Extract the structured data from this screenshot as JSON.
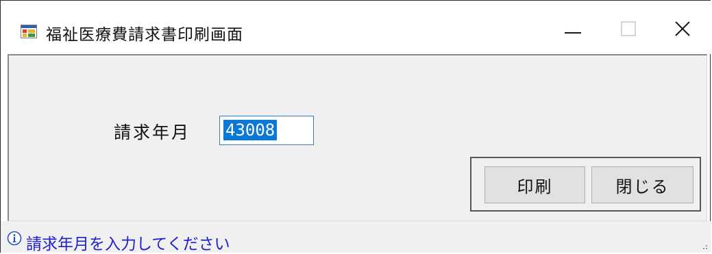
{
  "window": {
    "title": "福祉医療費請求書印刷画面",
    "app_icon": "form-window-icon",
    "controls": {
      "minimize_icon": "minimize-icon",
      "maximize_icon": "maximize-icon",
      "close_icon": "close-icon"
    }
  },
  "form": {
    "billing_month_label": "請求年月",
    "billing_month_value": "43008"
  },
  "buttons": {
    "print_label": "印刷",
    "close_label": "閉じる"
  },
  "statusbar": {
    "icon": "info-icon",
    "message": "請求年月を入力してください"
  },
  "colors": {
    "selection": "#0a78d7",
    "status_text": "#1f1fd2",
    "input_border": "#2f7cd1",
    "client_bg": "#f0f0f0"
  }
}
